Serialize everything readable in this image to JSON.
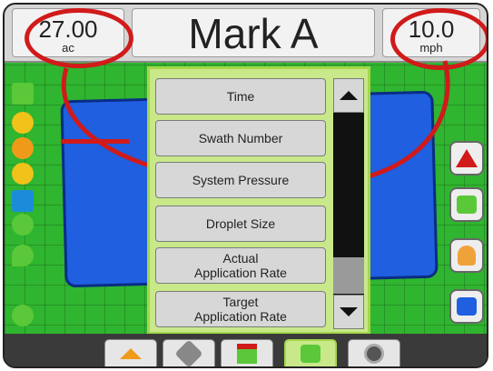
{
  "top": {
    "left": {
      "value": "27.00",
      "unit": "ac"
    },
    "title": "Mark A",
    "right": {
      "value": "10.0",
      "unit": "mph"
    }
  },
  "dropdown": {
    "items": [
      {
        "label": "Time"
      },
      {
        "label": "Swath Number"
      },
      {
        "label": "System Pressure"
      },
      {
        "label": "Droplet Size"
      },
      {
        "label_line1": "Actual",
        "label_line2": "Application Rate"
      },
      {
        "label_line1": "Target",
        "label_line2": "Application Rate"
      }
    ]
  },
  "icons": {
    "left_sidebar": [
      "boom-sections-icon",
      "swath-icon",
      "product-icon",
      "nozzle-icon",
      "boom-icon",
      "cone-icon",
      "droplet-icon",
      "link-icon"
    ],
    "right_sidebar": [
      "triangle-marker-icon",
      "bucket-icon",
      "hand-icon",
      "square-marker-icon"
    ],
    "bottom_nav": [
      "home-icon",
      "tools-icon",
      "guidance-view-icon",
      "marker-icon",
      "camera-icon"
    ]
  },
  "colors": {
    "field_green": "#2fb52f",
    "coverage_blue": "#1f5fe0",
    "highlight_red": "#d11a1a",
    "menu_green": "#c8e88a"
  }
}
